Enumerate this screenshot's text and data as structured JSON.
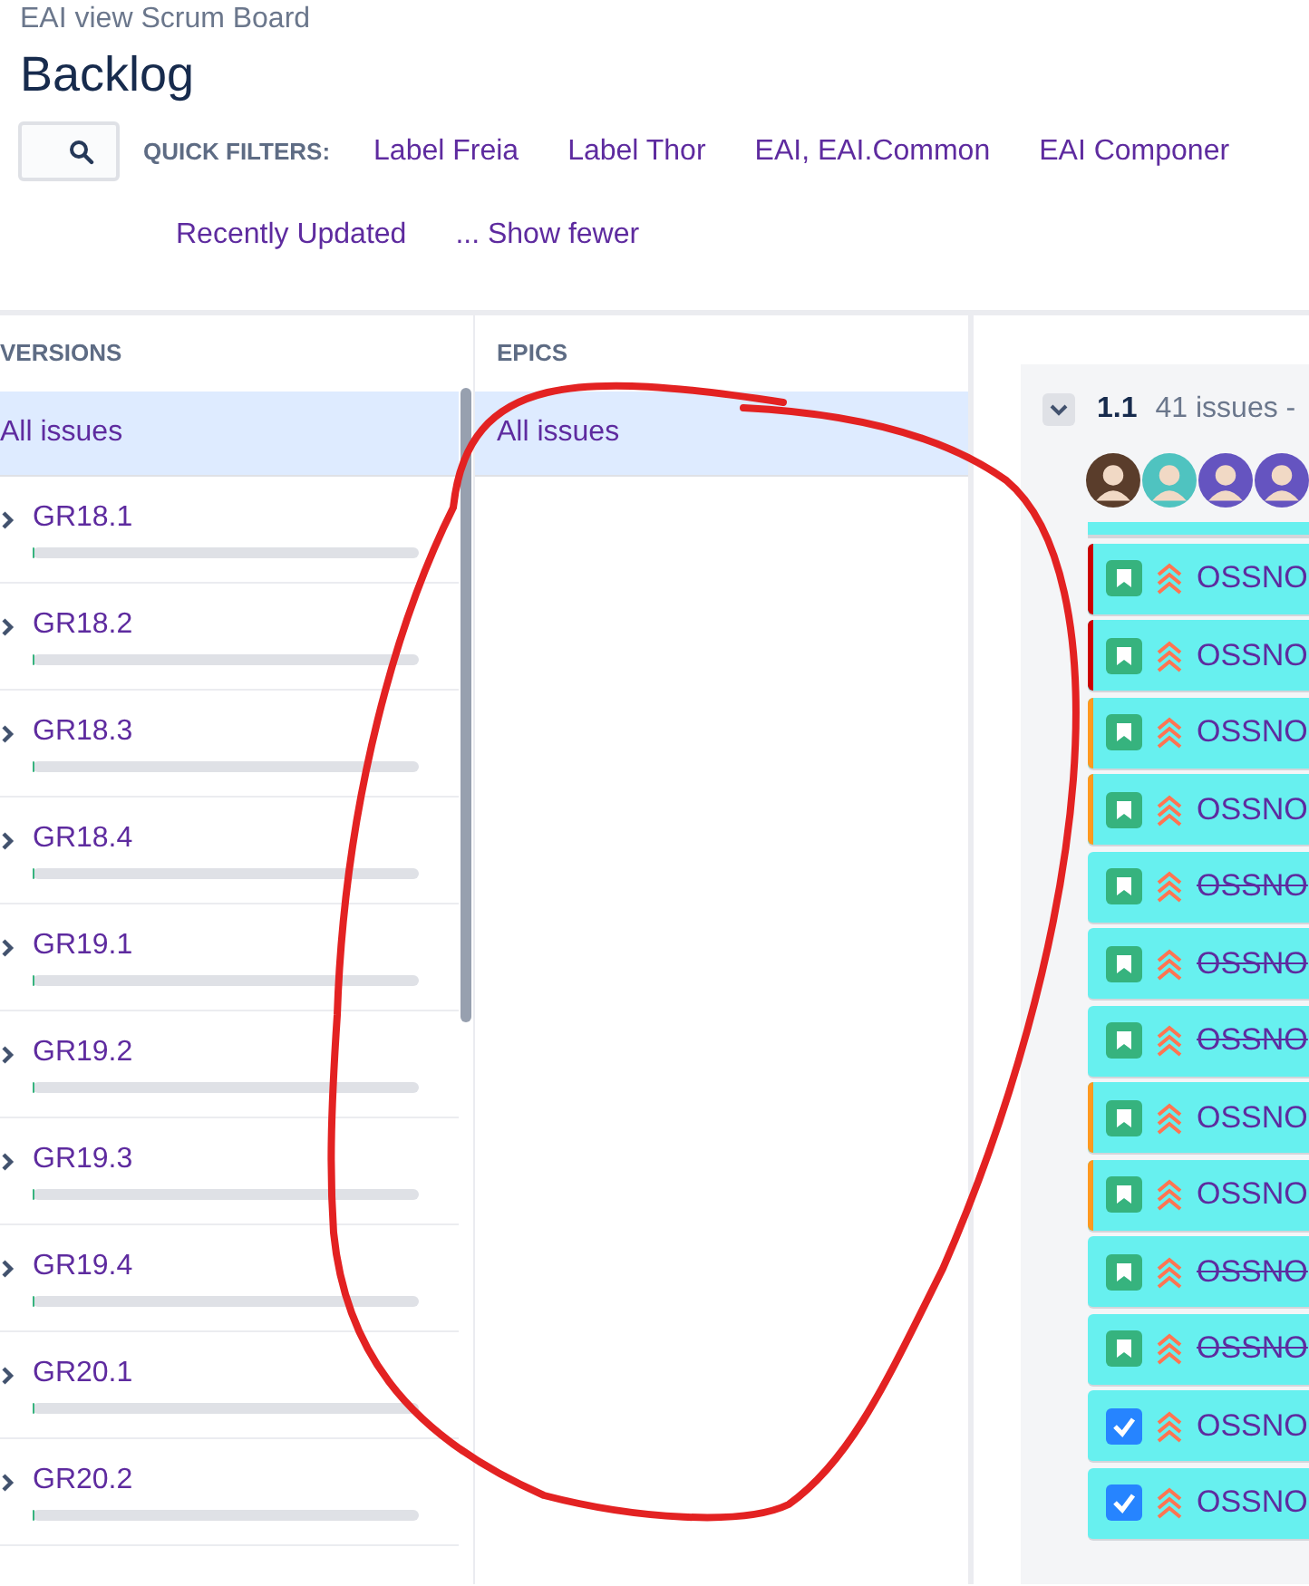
{
  "breadcrumb": "EAI view Scrum Board",
  "title": "Backlog",
  "quick_filters": {
    "label": "QUICK FILTERS:",
    "filters": [
      "Label Freia",
      "Label Thor",
      "EAI, EAI.Common",
      "EAI Componer",
      "Recently Updated"
    ],
    "toggle": "... Show fewer"
  },
  "versions": {
    "heading": "VERSIONS",
    "all": {
      "label": "All issues",
      "selected": true
    },
    "items": [
      {
        "name": "GR18.1",
        "level": 0
      },
      {
        "name": "GR18.2",
        "level": 0
      },
      {
        "name": "GR18.3",
        "level": 0
      },
      {
        "name": "GR18.4",
        "level": 0
      },
      {
        "name": "GR19.1",
        "level": 0
      },
      {
        "name": "GR19.2",
        "level": 0
      },
      {
        "name": "GR19.3",
        "level": 0
      },
      {
        "name": "GR19.4",
        "level": 0
      },
      {
        "name": "GR20.1",
        "level": 0
      },
      {
        "name": "GR20.2",
        "level": 0
      }
    ]
  },
  "epics": {
    "heading": "EPICS",
    "all": {
      "label": "All issues",
      "selected": true
    }
  },
  "sprint": {
    "name": "1.1",
    "count": "41 issues -",
    "expanded": true,
    "issues": [
      {
        "kind": "story",
        "key": "OSSNO",
        "done": false,
        "color": "#cc0000"
      },
      {
        "kind": "story",
        "key": "OSSNO",
        "done": false,
        "color": "#cc0000"
      },
      {
        "kind": "story",
        "key": "OSSNO",
        "done": false,
        "color": "#ff991f"
      },
      {
        "kind": "story",
        "key": "OSSNO",
        "done": false,
        "color": "#ff991f"
      },
      {
        "kind": "story",
        "key": "OSSNO",
        "done": true
      },
      {
        "kind": "story",
        "key": "OSSNO",
        "done": true
      },
      {
        "kind": "story",
        "key": "OSSNO",
        "done": true
      },
      {
        "kind": "story",
        "key": "OSSNO",
        "done": false,
        "color": "#ff991f"
      },
      {
        "kind": "story",
        "key": "OSSNO",
        "done": false,
        "color": "#ff991f"
      },
      {
        "kind": "story",
        "key": "OSSNO",
        "done": true
      },
      {
        "kind": "story",
        "key": "OSSNO",
        "done": true
      },
      {
        "kind": "task",
        "key": "OSSNO",
        "done": false
      },
      {
        "kind": "task",
        "key": "OSSNO",
        "done": false
      }
    ]
  }
}
